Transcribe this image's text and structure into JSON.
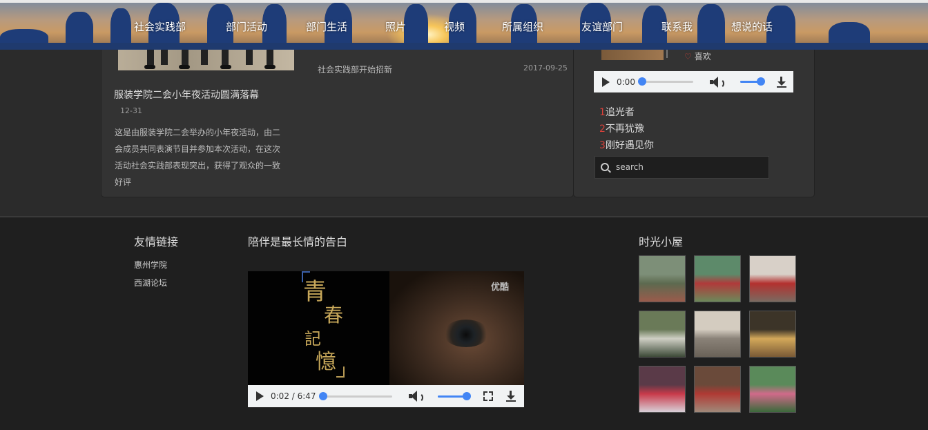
{
  "nav": {
    "items": [
      "社会实践部",
      "部门活动",
      "部门生活",
      "照片",
      "视频",
      "所属组织",
      "友谊部门",
      "联系我",
      "想说的话"
    ]
  },
  "article": {
    "title": "服装学院二会小年夜活动圆满落幕",
    "date": "12-31",
    "body": "这是由服装学院二会举办的小年夜活动，由二会成员共同表演节目并参加本次活动，在这次活动社会实践部表现突出，获得了观众的一致好评"
  },
  "news": {
    "title": "社会实践部开始招新",
    "date": "2017-09-25"
  },
  "sidebar": {
    "like_label": "喜欢",
    "audio": {
      "time": "0:00",
      "progress": 0,
      "volume": 1.0
    },
    "playlist": [
      {
        "num": "1",
        "title": "追光者"
      },
      {
        "num": "2",
        "title": "不再犹豫"
      },
      {
        "num": "3",
        "title": "刚好遇见你"
      }
    ],
    "search": {
      "placeholder": "search"
    }
  },
  "footer": {
    "links_title": "友情链接",
    "links": [
      "惠州学院",
      "西湖论坛"
    ],
    "video_title": "陪伴是最长情的告白",
    "video": {
      "poster_text": [
        "青",
        "春",
        "記",
        "憶"
      ],
      "brand": "优酷",
      "time": "0:02 / 6:47",
      "progress": 0.005,
      "volume": 1.0
    },
    "gallery_title": "时光小屋",
    "gallery": [
      {
        "colors": [
          "#7d8f78",
          "#5d6a4f",
          "#9a5b4c"
        ]
      },
      {
        "colors": [
          "#5d8a6a",
          "#b03a3a",
          "#6b8a5a"
        ]
      },
      {
        "colors": [
          "#d8d0c8",
          "#b3312f",
          "#7a6a60"
        ]
      },
      {
        "colors": [
          "#6a7a58",
          "#cfcfc4",
          "#3d4a38"
        ]
      },
      {
        "colors": [
          "#d4ccc0",
          "#8a8278",
          "#6a6258"
        ]
      },
      {
        "colors": [
          "#3c3428",
          "#d3a85a",
          "#7a5a36"
        ]
      },
      {
        "colors": [
          "#5a3a48",
          "#c83a4a",
          "#d8d0d8"
        ]
      },
      {
        "colors": [
          "#6a4a3a",
          "#b03a34",
          "#a08a7a"
        ]
      },
      {
        "colors": [
          "#5a8a5a",
          "#d06a8a",
          "#3a6a3a"
        ]
      }
    ]
  }
}
